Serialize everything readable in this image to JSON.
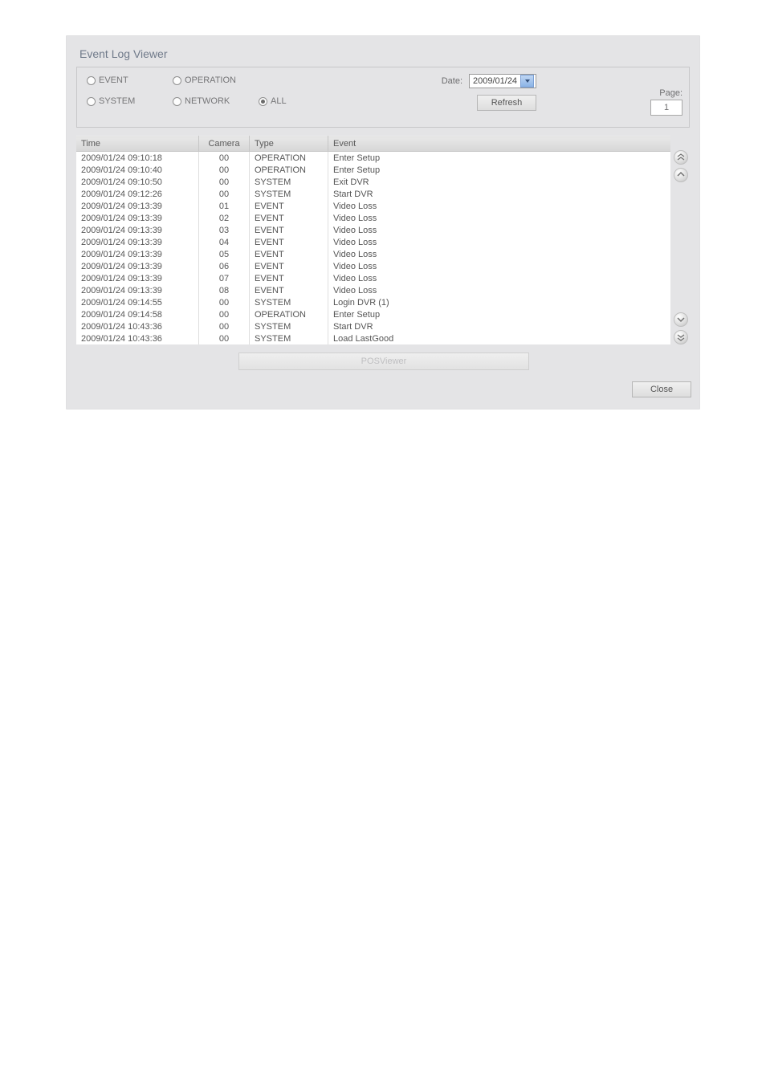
{
  "title": "Event Log Viewer",
  "filters": {
    "event": {
      "label": "EVENT",
      "selected": false
    },
    "operation": {
      "label": "OPERATION",
      "selected": false
    },
    "system": {
      "label": "SYSTEM",
      "selected": false
    },
    "network": {
      "label": "NETWORK",
      "selected": false
    },
    "all": {
      "label": "ALL",
      "selected": true
    }
  },
  "date": {
    "label": "Date:",
    "value": "2009/01/24"
  },
  "buttons": {
    "refresh": "Refresh",
    "posviewer": "POSViewer",
    "close": "Close"
  },
  "page": {
    "label": "Page:",
    "value": "1"
  },
  "columns": {
    "time": "Time",
    "camera": "Camera",
    "type": "Type",
    "event": "Event"
  },
  "rows": [
    {
      "time": "2009/01/24 09:10:18",
      "camera": "00",
      "type": "OPERATION",
      "event": "Enter Setup"
    },
    {
      "time": "2009/01/24 09:10:40",
      "camera": "00",
      "type": "OPERATION",
      "event": "Enter Setup"
    },
    {
      "time": "2009/01/24 09:10:50",
      "camera": "00",
      "type": "SYSTEM",
      "event": "Exit DVR"
    },
    {
      "time": "2009/01/24 09:12:26",
      "camera": "00",
      "type": "SYSTEM",
      "event": "Start DVR"
    },
    {
      "time": "2009/01/24 09:13:39",
      "camera": "01",
      "type": "EVENT",
      "event": "Video Loss"
    },
    {
      "time": "2009/01/24 09:13:39",
      "camera": "02",
      "type": "EVENT",
      "event": "Video Loss"
    },
    {
      "time": "2009/01/24 09:13:39",
      "camera": "03",
      "type": "EVENT",
      "event": "Video Loss"
    },
    {
      "time": "2009/01/24 09:13:39",
      "camera": "04",
      "type": "EVENT",
      "event": "Video Loss"
    },
    {
      "time": "2009/01/24 09:13:39",
      "camera": "05",
      "type": "EVENT",
      "event": "Video Loss"
    },
    {
      "time": "2009/01/24 09:13:39",
      "camera": "06",
      "type": "EVENT",
      "event": "Video Loss"
    },
    {
      "time": "2009/01/24 09:13:39",
      "camera": "07",
      "type": "EVENT",
      "event": "Video Loss"
    },
    {
      "time": "2009/01/24 09:13:39",
      "camera": "08",
      "type": "EVENT",
      "event": "Video Loss"
    },
    {
      "time": "2009/01/24 09:14:55",
      "camera": "00",
      "type": "SYSTEM",
      "event": "Login DVR (1)"
    },
    {
      "time": "2009/01/24 09:14:58",
      "camera": "00",
      "type": "OPERATION",
      "event": "Enter Setup"
    },
    {
      "time": "2009/01/24 10:43:36",
      "camera": "00",
      "type": "SYSTEM",
      "event": "Start DVR"
    },
    {
      "time": "2009/01/24 10:43:36",
      "camera": "00",
      "type": "SYSTEM",
      "event": "Load LastGood"
    }
  ]
}
